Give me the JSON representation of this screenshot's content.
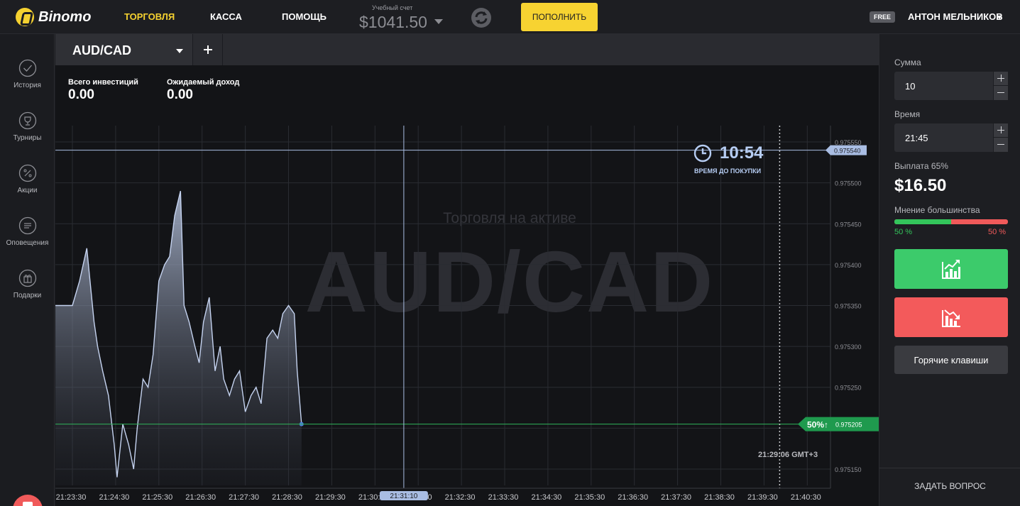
{
  "brand": {
    "name": "Binomo",
    "color": "#f5d130"
  },
  "nav": {
    "trading": "ТОРГОВЛЯ",
    "cashier": "КАССА",
    "help": "ПОМОЩЬ"
  },
  "account": {
    "label": "Учебный счет",
    "balance": "$1041.50"
  },
  "header": {
    "deposit_label": "ПОПОЛНИТЬ",
    "free_badge": "FREE",
    "username": "АНТОН МЕЛЬНИКОВ"
  },
  "sidebar": {
    "items": [
      {
        "label": "История",
        "icon": "check-circle-icon"
      },
      {
        "label": "Турниры",
        "icon": "trophy-icon"
      },
      {
        "label": "Акции",
        "icon": "percent-icon"
      },
      {
        "label": "Оповещения",
        "icon": "notifications-icon"
      },
      {
        "label": "Подарки",
        "icon": "gift-icon"
      }
    ]
  },
  "tabs": {
    "asset": "AUD/CAD"
  },
  "stats": {
    "total_investments_label": "Всего инвестиций",
    "total_investments_value": "0.00",
    "expected_income_label": "Ожидаемый доход",
    "expected_income_value": "0.00"
  },
  "chart_overlay": {
    "watermark": "AUD/CAD",
    "subtitle": "Торговля на активе",
    "timer_value": "10:54",
    "timer_label": "ВРЕМЯ ДО ПОКУПКИ",
    "server_time": "21:29:06 GMT+3",
    "current_price_label": "0.975205",
    "current_price_pct": "50%↑",
    "target_price_label": "0.975540",
    "cursor_time_label": "21:31:10"
  },
  "chart_data": {
    "type": "area",
    "x_ticks": [
      "21:23:30",
      "21:24:30",
      "21:25:30",
      "21:26:30",
      "21:27:30",
      "21:28:30",
      "21:29:30",
      "21:30:30",
      "21:31:30",
      "21:32:30",
      "21:33:30",
      "21:34:30",
      "21:35:30",
      "21:36:30",
      "21:37:30",
      "21:38:30",
      "21:39:30",
      "21:40:30"
    ],
    "y_ticks": [
      "0.975150",
      "0.975200",
      "0.975250",
      "0.975300",
      "0.975350",
      "0.975400",
      "0.975450",
      "0.975500",
      "0.975550"
    ],
    "ylim": [
      0.97513,
      0.97557
    ],
    "grid": true,
    "series": [
      {
        "points": [
          [
            "21:23:30",
            0.97535
          ],
          [
            "21:23:40",
            0.97538
          ],
          [
            "21:23:50",
            0.97542
          ],
          [
            "21:24:00",
            0.97533
          ],
          [
            "21:24:05",
            0.9753
          ],
          [
            "21:24:12",
            0.97527
          ],
          [
            "21:24:20",
            0.97524
          ],
          [
            "21:24:28",
            0.97518
          ],
          [
            "21:24:32",
            0.97514
          ],
          [
            "21:24:40",
            0.975205
          ],
          [
            "21:24:48",
            0.97518
          ],
          [
            "21:24:55",
            0.97515
          ],
          [
            "21:25:00",
            0.9752
          ],
          [
            "21:25:08",
            0.97526
          ],
          [
            "21:25:15",
            0.97525
          ],
          [
            "21:25:22",
            0.97529
          ],
          [
            "21:25:30",
            0.97538
          ],
          [
            "21:25:38",
            0.9754
          ],
          [
            "21:25:45",
            0.97541
          ],
          [
            "21:25:52",
            0.97546
          ],
          [
            "21:26:00",
            0.97549
          ],
          [
            "21:26:05",
            0.97535
          ],
          [
            "21:26:12",
            0.97533
          ],
          [
            "21:26:20",
            0.9753
          ],
          [
            "21:26:26",
            0.97528
          ],
          [
            "21:26:32",
            0.97533
          ],
          [
            "21:26:40",
            0.97536
          ],
          [
            "21:26:48",
            0.97527
          ],
          [
            "21:26:55",
            0.9753
          ],
          [
            "21:27:00",
            0.97526
          ],
          [
            "21:27:08",
            0.97524
          ],
          [
            "21:27:15",
            0.97526
          ],
          [
            "21:27:22",
            0.97527
          ],
          [
            "21:27:30",
            0.97522
          ],
          [
            "21:27:38",
            0.97524
          ],
          [
            "21:27:45",
            0.97525
          ],
          [
            "21:27:52",
            0.97523
          ],
          [
            "21:28:00",
            0.97531
          ],
          [
            "21:28:08",
            0.97532
          ],
          [
            "21:28:15",
            0.97531
          ],
          [
            "21:28:22",
            0.97534
          ],
          [
            "21:28:30",
            0.97535
          ],
          [
            "21:28:38",
            0.97534
          ],
          [
            "21:28:42",
            0.97527
          ],
          [
            "21:28:48",
            0.975205
          ]
        ]
      }
    ]
  },
  "right_panel": {
    "amount_label": "Сумма",
    "amount_value": "10",
    "time_label": "Время",
    "time_value": "21:45",
    "payout_label": "Выплата 65%",
    "payout_value": "$16.50",
    "majority_label": "Мнение большинства",
    "majority_up": "50 %",
    "majority_down": "50 %",
    "majority_up_fraction": 0.5,
    "hotkeys_label": "Горячие клавиши",
    "ask_label": "ЗАДАТЬ ВОПРОС"
  },
  "colors": {
    "up": "#3ccb6b",
    "down": "#f35a5b",
    "accent": "#f7d331",
    "line": "#b6cdf3"
  }
}
